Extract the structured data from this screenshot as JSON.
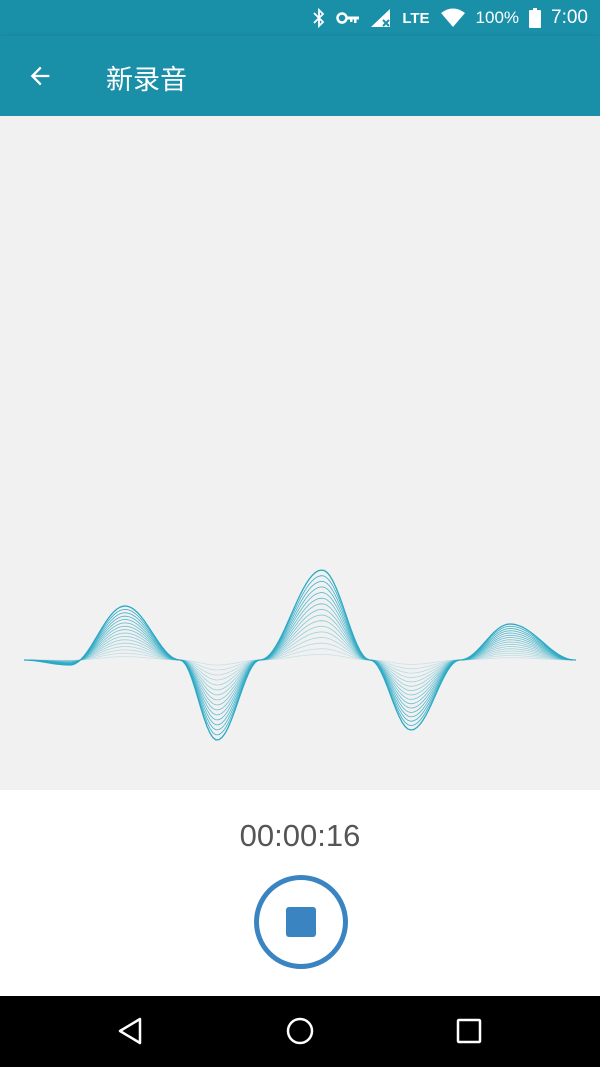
{
  "status_bar": {
    "battery_percent": "100%",
    "time": "7:00",
    "network": "LTE",
    "icons": [
      "bluetooth-icon",
      "vpn-key-icon",
      "signal-icon",
      "wifi-icon",
      "battery-icon"
    ]
  },
  "app_bar": {
    "title": "新录音",
    "back_icon": "arrow-back-icon"
  },
  "recorder": {
    "elapsed": "00:00:16",
    "stop_icon": "stop-icon"
  },
  "nav_bar": {
    "icons": [
      "back-triangle-icon",
      "home-circle-icon",
      "recents-square-icon"
    ]
  },
  "colors": {
    "primary": "#1a8fa8",
    "accent": "#3a84c2",
    "wave": "#2aa9c4"
  }
}
